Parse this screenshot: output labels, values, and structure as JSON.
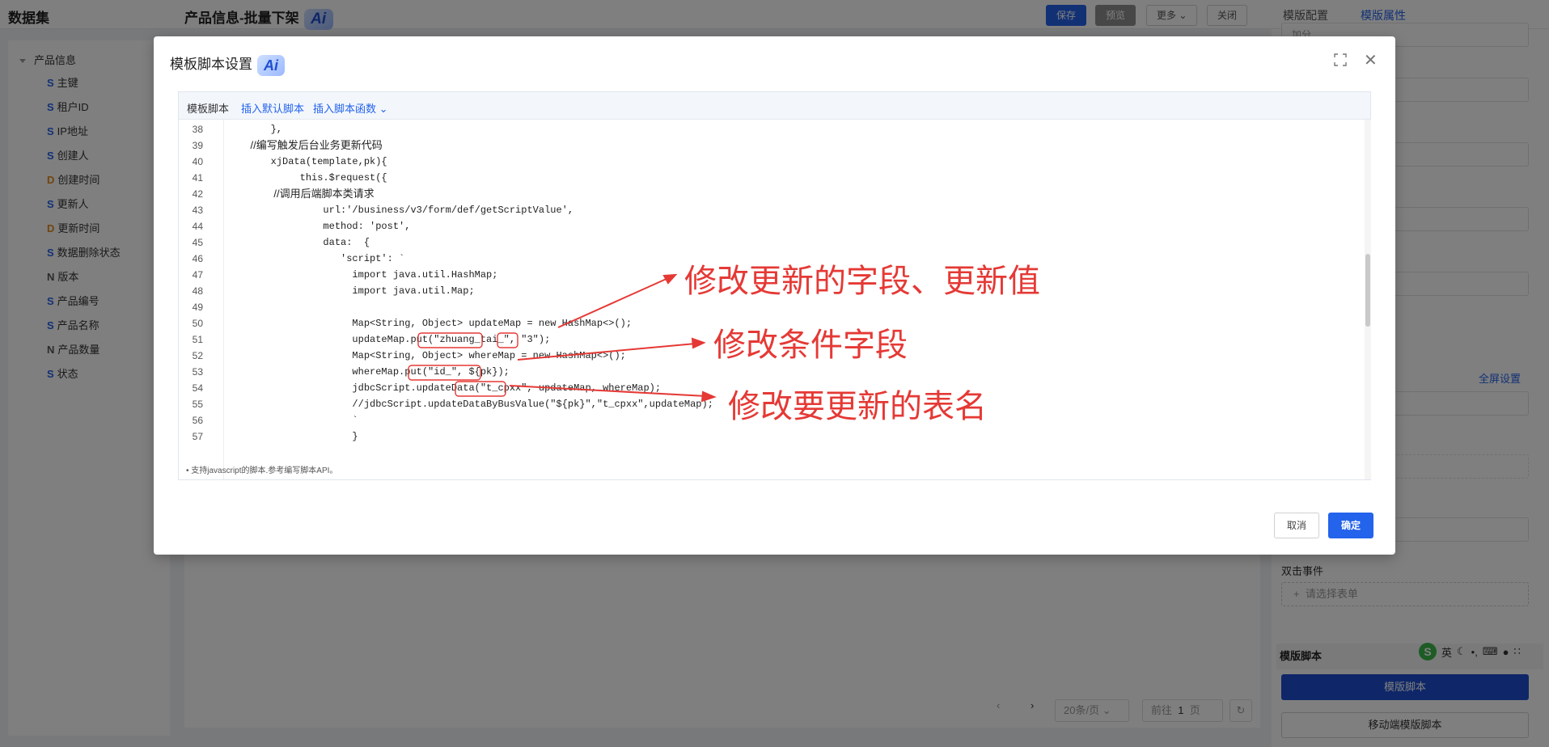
{
  "app": {
    "title": "数据集",
    "page_title": "产品信息-批量下架",
    "ai_label": "Ai"
  },
  "toolbar": {
    "save": "保存",
    "preview": "预览",
    "more": "更多",
    "close": "关闭"
  },
  "right_tabs": [
    "模版配置",
    "模版属性"
  ],
  "tree": {
    "root": "产品信息",
    "items": [
      {
        "type": "S",
        "label": "主键"
      },
      {
        "type": "S",
        "label": "租户ID"
      },
      {
        "type": "S",
        "label": "IP地址"
      },
      {
        "type": "S",
        "label": "创建人"
      },
      {
        "type": "D",
        "label": "创建时间"
      },
      {
        "type": "S",
        "label": "更新人"
      },
      {
        "type": "D",
        "label": "更新时间"
      },
      {
        "type": "S",
        "label": "数据删除状态"
      },
      {
        "type": "N",
        "label": "版本"
      },
      {
        "type": "S",
        "label": "产品编号"
      },
      {
        "type": "S",
        "label": "产品名称"
      },
      {
        "type": "N",
        "label": "产品数量"
      },
      {
        "type": "S",
        "label": "状态"
      }
    ]
  },
  "pagination": {
    "page_size": "20条/页",
    "goto_label": "前往",
    "page": "1",
    "page_suffix": "页"
  },
  "right_panel": {
    "top_partial": "加分",
    "fullscreen_link": "全屏设置",
    "dblclick_label": "双击事件",
    "dblclick_placeholder": "请选择表单",
    "section_title": "模版脚本",
    "script_button": "模版脚本",
    "mobile_script_button": "移动端模版脚本"
  },
  "ime": {
    "label": "英"
  },
  "dialog": {
    "title": "模板脚本设置",
    "tabs": [
      "模板脚本",
      "插入默认脚本",
      "插入脚本函数"
    ],
    "code_lines": [
      {
        "n": "38",
        "text": "        },",
        "cmt": false
      },
      {
        "n": "39",
        "text": "         //编写触发后台业务更新代码",
        "cmt": true
      },
      {
        "n": "40",
        "text": "        xjData(template,pk){",
        "cmt": false
      },
      {
        "n": "41",
        "text": "             this.$request({",
        "cmt": false
      },
      {
        "n": "42",
        "text": "                 //调用后端脚本类请求",
        "cmt": true
      },
      {
        "n": "43",
        "text": "                 url:'/business/v3/form/def/getScriptValue',",
        "cmt": false
      },
      {
        "n": "44",
        "text": "                 method: 'post',",
        "cmt": false
      },
      {
        "n": "45",
        "text": "                 data:  {",
        "cmt": false
      },
      {
        "n": "46",
        "text": "                    'script': `",
        "cmt": false
      },
      {
        "n": "47",
        "text": "                      import java.util.HashMap;",
        "cmt": false
      },
      {
        "n": "48",
        "text": "                      import java.util.Map;",
        "cmt": false
      },
      {
        "n": "49",
        "text": "",
        "cmt": false
      },
      {
        "n": "50",
        "text": "                      Map<String, Object> updateMap = new HashMap<>();",
        "cmt": false
      },
      {
        "n": "51",
        "text": "                      updateMap.put(\"zhuang_tai_\", \"3\");",
        "cmt": false
      },
      {
        "n": "52",
        "text": "                      Map<String, Object> whereMap = new HashMap<>();",
        "cmt": false
      },
      {
        "n": "53",
        "text": "                      whereMap.put(\"id_\", ${pk});",
        "cmt": false
      },
      {
        "n": "54",
        "text": "                      jdbcScript.updateData(\"t_cpxx\", updateMap, whereMap);",
        "cmt": false
      },
      {
        "n": "55",
        "text": "                      //jdbcScript.updateDataByBusValue(\"${pk}\",\"t_cpxx\",updateMap);",
        "cmt": false
      },
      {
        "n": "56",
        "text": "                      `",
        "cmt": false
      },
      {
        "n": "57",
        "text": "                      }",
        "cmt": false
      }
    ],
    "note": "•  支持javascript的脚本.参考编写脚本API。",
    "cancel": "取消",
    "confirm": "确定"
  },
  "annotations": [
    "修改更新的字段、更新值",
    "修改条件字段",
    "修改要更新的表名"
  ],
  "colors": {
    "primary": "#2463eb",
    "annotation": "#e53935"
  }
}
